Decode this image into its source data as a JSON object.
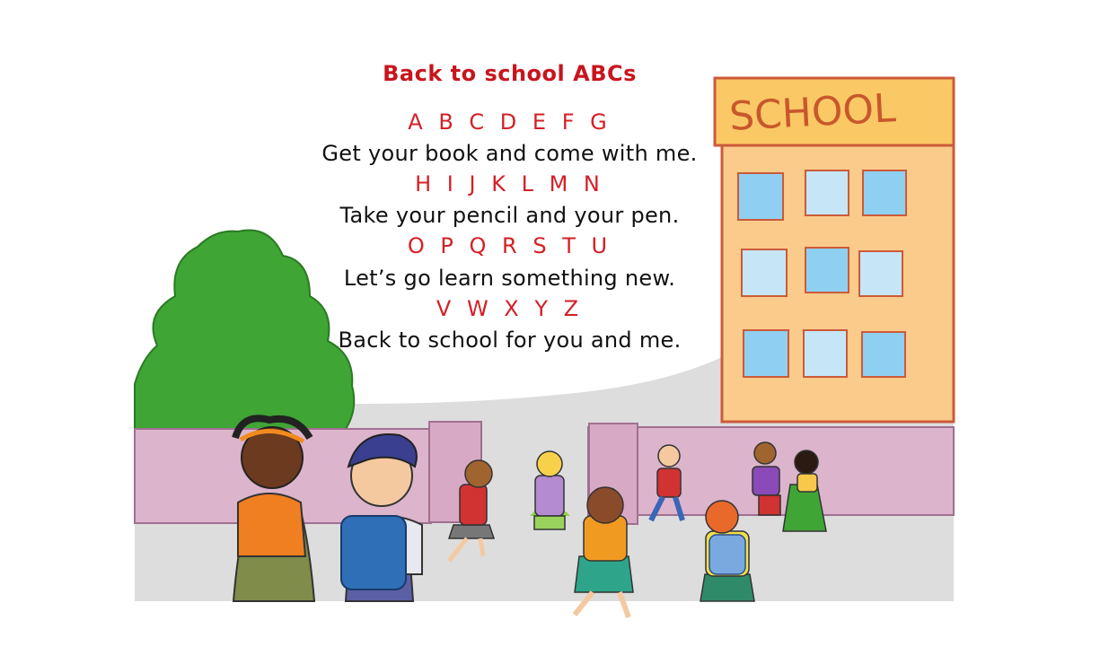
{
  "poem": {
    "title": "Back to school ABCs",
    "stanzas": [
      {
        "letters": "A B C D E F G",
        "line": "Get your book and come with me."
      },
      {
        "letters": "H I J K L M N",
        "line": "Take your pencil and your pen."
      },
      {
        "letters": "O P Q R S T U",
        "line": "Let’s go learn something new."
      },
      {
        "letters": "V W X Y Z",
        "line": "Back to school for you and me."
      }
    ]
  },
  "illustration": {
    "sign_text": "SCHOOL",
    "colors": {
      "building": "#fbcb8c",
      "sign": "#fbc866",
      "outline": "#cc5a3a",
      "window": "#8fd0f2",
      "tree": "#3fa535",
      "wall": "#dcb4cc",
      "ground": "#dcdcdc",
      "title_red": "#c8151d"
    }
  }
}
